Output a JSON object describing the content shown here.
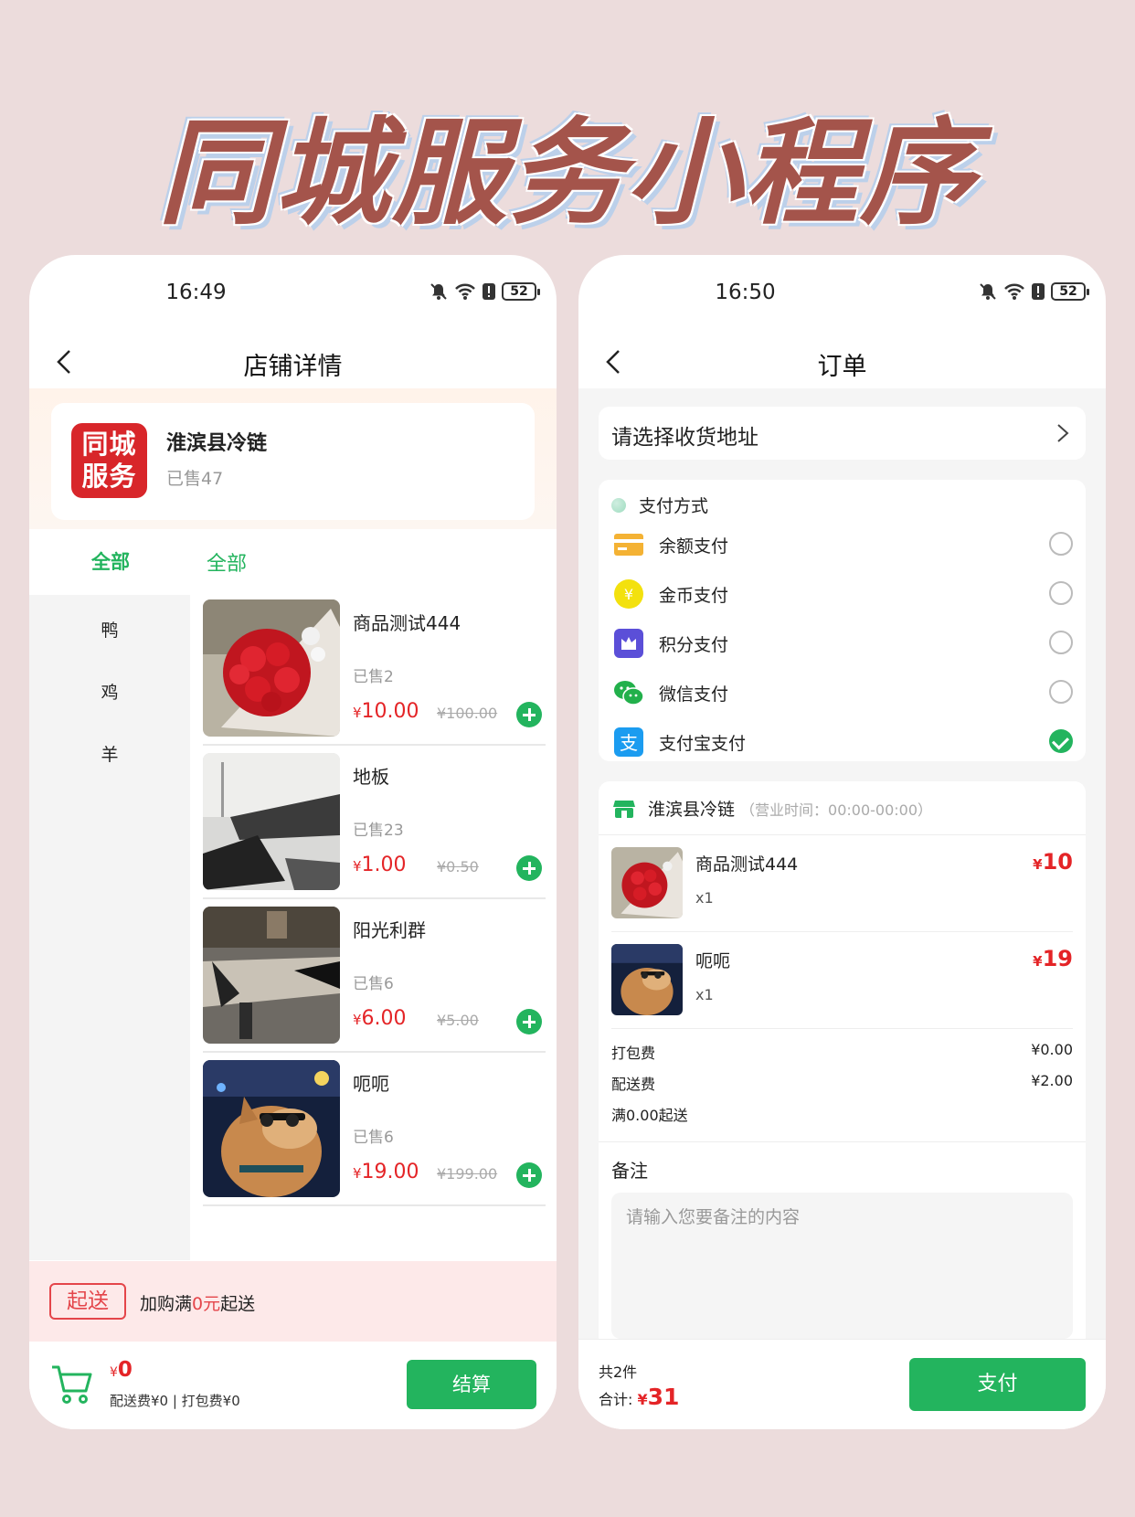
{
  "banner_title": "同城服务小程序",
  "left_phone": {
    "status": {
      "time": "16:49",
      "battery": "52"
    },
    "nav_title": "店铺详情",
    "shop": {
      "logo_text_1": "同城",
      "logo_text_2": "服务",
      "name": "淮滨县冷链",
      "sold": "已售47"
    },
    "tabs": {
      "left_all": "全部",
      "right_all": "全部"
    },
    "categories": [
      "鸭",
      "鸡",
      "羊"
    ],
    "products": [
      {
        "name": "商品测试444",
        "sold": "已售2",
        "price": "10.00",
        "orig": "¥100.00"
      },
      {
        "name": "地板",
        "sold": "已售23",
        "price": "1.00",
        "orig": "¥0.50"
      },
      {
        "name": "阳光利群",
        "sold": "已售6",
        "price": "6.00",
        "orig": "¥5.00"
      },
      {
        "name": "呃呃",
        "sold": "已售6",
        "price": "19.00",
        "orig": "¥199.00"
      }
    ],
    "delivery": {
      "tag": "起送",
      "prefix": "加购满",
      "amount": "0元",
      "suffix": "起送"
    },
    "cart": {
      "currency": "¥",
      "total": "0",
      "sub": "配送费¥0 | 打包费¥0",
      "checkout": "结算"
    }
  },
  "right_phone": {
    "status": {
      "time": "16:50",
      "battery": "52"
    },
    "nav_title": "订单",
    "address_prompt": "请选择收货地址",
    "payment": {
      "header": "支付方式",
      "methods": [
        {
          "label": "余额支付",
          "icon": "card-icon",
          "selected": false
        },
        {
          "label": "金币支付",
          "icon": "coin-icon",
          "selected": false
        },
        {
          "label": "积分支付",
          "icon": "points-icon",
          "selected": false
        },
        {
          "label": "微信支付",
          "icon": "wechat-icon",
          "selected": false
        },
        {
          "label": "支付宝支付",
          "icon": "alipay-icon",
          "selected": true
        }
      ]
    },
    "order": {
      "shop_name": "淮滨县冷链",
      "hours": "（营业时间：00:00-00:00）",
      "items": [
        {
          "name": "商品测试444",
          "qty": "x1",
          "price": "10"
        },
        {
          "name": "呃呃",
          "qty": "x1",
          "price": "19"
        }
      ],
      "fees": [
        {
          "label": "打包费",
          "value": "¥0.00"
        },
        {
          "label": "配送费",
          "value": "¥2.00"
        },
        {
          "label": "满0.00起送",
          "value": ""
        }
      ],
      "note_label": "备注",
      "note_placeholder": "请输入您要备注的内容"
    },
    "footer": {
      "count": "共2件",
      "total_label": "合计:",
      "currency": "¥",
      "total": "31",
      "pay": "支付"
    }
  },
  "colors": {
    "accent": "#23b45e",
    "price": "#e42427",
    "banner": "#a4544b"
  }
}
